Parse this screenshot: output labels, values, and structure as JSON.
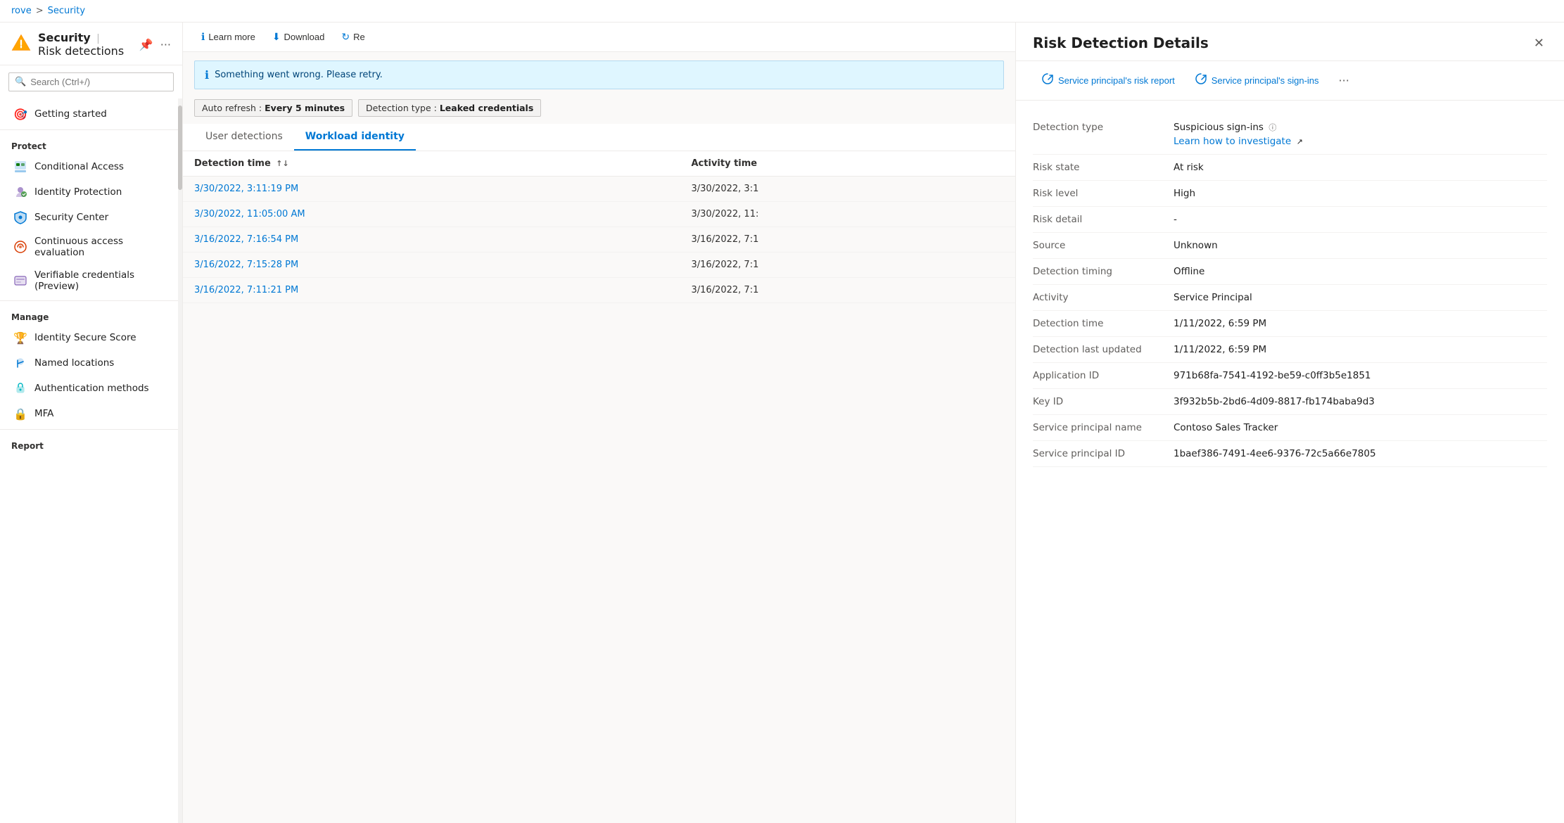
{
  "breadcrumb": {
    "parent": "rove",
    "separator": ">",
    "current": "Security"
  },
  "page": {
    "title": "Security",
    "separator": "|",
    "subtitle": "Risk detections",
    "pin_icon": "📌",
    "ellipsis_icon": "..."
  },
  "search": {
    "placeholder": "Search (Ctrl+/)"
  },
  "sidebar": {
    "nav_items": [
      {
        "id": "getting-started",
        "label": "Getting started",
        "icon": "🎯",
        "section": null
      }
    ],
    "protect_label": "Protect",
    "protect_items": [
      {
        "id": "conditional-access",
        "label": "Conditional Access",
        "icon": "CA"
      },
      {
        "id": "identity-protection",
        "label": "Identity Protection",
        "icon": "IP"
      },
      {
        "id": "security-center",
        "label": "Security Center",
        "icon": "SC"
      },
      {
        "id": "continuous-access",
        "label": "Continuous access evaluation",
        "icon": "CE"
      },
      {
        "id": "verifiable-credentials",
        "label": "Verifiable credentials (Preview)",
        "icon": "VC"
      }
    ],
    "manage_label": "Manage",
    "manage_items": [
      {
        "id": "identity-secure-score",
        "label": "Identity Secure Score",
        "icon": "🏆"
      },
      {
        "id": "named-locations",
        "label": "Named locations",
        "icon": "NL"
      },
      {
        "id": "authentication-methods",
        "label": "Authentication methods",
        "icon": "AM"
      },
      {
        "id": "mfa",
        "label": "MFA",
        "icon": "🔒"
      }
    ],
    "report_label": "Report"
  },
  "toolbar": {
    "learn_more": "Learn more",
    "download": "Download",
    "refresh": "Re"
  },
  "info_message": "Something went wrong. Please retry.",
  "filter_chips": [
    {
      "label": "Auto refresh",
      "value": "Every 5 minutes"
    },
    {
      "label": "Detection type",
      "value": "Leaked credentials"
    }
  ],
  "tabs": [
    {
      "id": "user-detections",
      "label": "User detections",
      "active": false
    },
    {
      "id": "workload-identity",
      "label": "Workload identity",
      "active": true
    }
  ],
  "table": {
    "columns": [
      {
        "id": "detection-time",
        "label": "Detection time",
        "sortable": true
      },
      {
        "id": "activity-time",
        "label": "Activity time",
        "sortable": false
      }
    ],
    "rows": [
      {
        "detection_time": "3/30/2022, 3:11:19 PM",
        "activity_time": "3/30/2022, 3:1"
      },
      {
        "detection_time": "3/30/2022, 11:05:00 AM",
        "activity_time": "3/30/2022, 11:"
      },
      {
        "detection_time": "3/16/2022, 7:16:54 PM",
        "activity_time": "3/16/2022, 7:1"
      },
      {
        "detection_time": "3/16/2022, 7:15:28 PM",
        "activity_time": "3/16/2022, 7:1"
      },
      {
        "detection_time": "3/16/2022, 7:11:21 PM",
        "activity_time": "3/16/2022, 7:1"
      }
    ]
  },
  "detail_panel": {
    "title": "Risk Detection Details",
    "action_buttons": [
      {
        "id": "risk-report",
        "label": "Service principal's risk report",
        "icon": "🔄"
      },
      {
        "id": "sign-ins",
        "label": "Service principal's sign-ins",
        "icon": "🔄"
      }
    ],
    "fields": [
      {
        "label": "Detection type",
        "value": "Suspicious sign-ins",
        "type": "text",
        "has_info": true,
        "link": "Learn how to investigate ↗",
        "link_url": "#"
      },
      {
        "label": "Risk state",
        "value": "At risk"
      },
      {
        "label": "Risk level",
        "value": "High"
      },
      {
        "label": "Risk detail",
        "value": "-"
      },
      {
        "label": "Source",
        "value": "Unknown"
      },
      {
        "label": "Detection timing",
        "value": "Offline"
      },
      {
        "label": "Activity",
        "value": "Service Principal"
      },
      {
        "label": "Detection time",
        "value": "1/11/2022, 6:59 PM"
      },
      {
        "label": "Detection last updated",
        "value": "1/11/2022, 6:59 PM"
      },
      {
        "label": "Application ID",
        "value": "971b68fa-7541-4192-be59-c0ff3b5e1851"
      },
      {
        "label": "Key ID",
        "value": "3f932b5b-2bd6-4d09-8817-fb174baba9d3"
      },
      {
        "label": "Service principal name",
        "value": "Contoso Sales Tracker"
      },
      {
        "label": "Service principal ID",
        "value": "1baef386-7491-4ee6-9376-72c5a66e7805"
      }
    ]
  }
}
